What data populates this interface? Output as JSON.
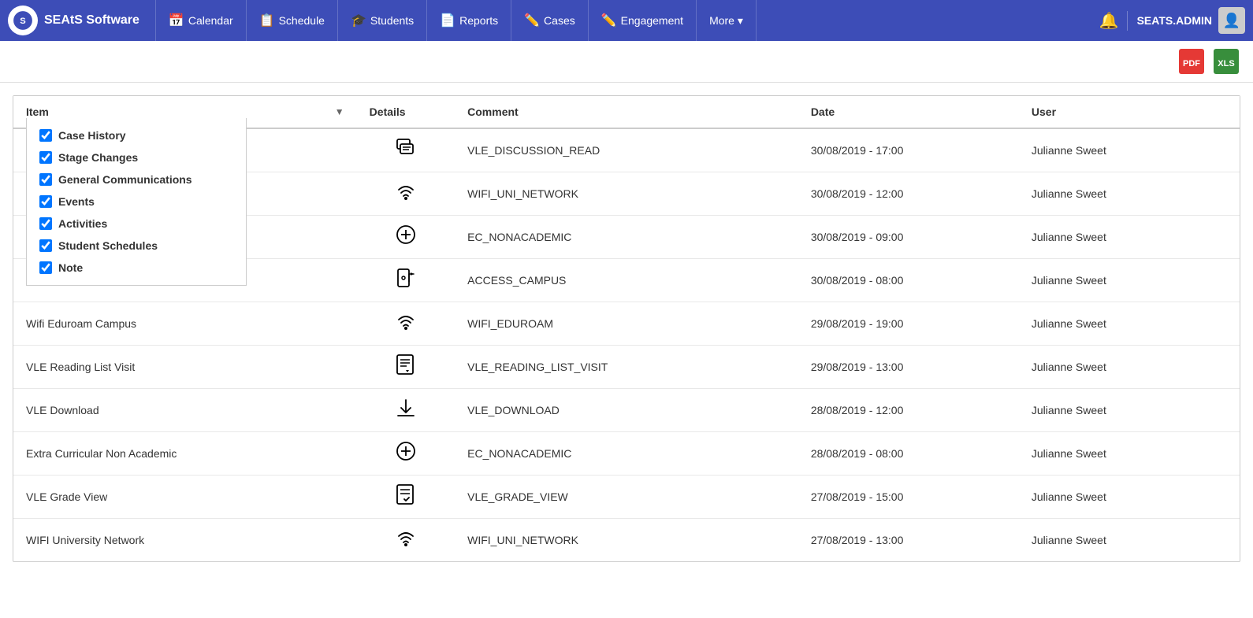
{
  "brand": {
    "name": "SEAtS Software"
  },
  "nav": {
    "items": [
      {
        "label": "Calendar",
        "icon": "📅"
      },
      {
        "label": "Schedule",
        "icon": "📋"
      },
      {
        "label": "Students",
        "icon": "🎓"
      },
      {
        "label": "Reports",
        "icon": "📄"
      },
      {
        "label": "Cases",
        "icon": "✏️"
      },
      {
        "label": "Engagement",
        "icon": "✏️"
      },
      {
        "label": "More ▾",
        "icon": ""
      }
    ]
  },
  "user": {
    "name": "SEATS.ADMIN"
  },
  "toolbar": {
    "pdf_label": "PDF",
    "excel_label": "XLS"
  },
  "table": {
    "columns": {
      "item": "Item",
      "details": "Details",
      "comment": "Comment",
      "date": "Date",
      "user": "User"
    },
    "dropdown_items": [
      {
        "label": "Case History",
        "checked": true
      },
      {
        "label": "Stage Changes",
        "checked": true
      },
      {
        "label": "General Communications",
        "checked": true
      },
      {
        "label": "Events",
        "checked": true
      },
      {
        "label": "Activities",
        "checked": true
      },
      {
        "label": "Student Schedules",
        "checked": true
      },
      {
        "label": "Note",
        "checked": true
      }
    ],
    "rows": [
      {
        "item": "",
        "icon": "💬",
        "comment": "VLE_DISCUSSION_READ",
        "date": "30/08/2019 - 17:00",
        "user": "Julianne Sweet"
      },
      {
        "item": "",
        "icon": "📶",
        "comment": "WIFI_UNI_NETWORK",
        "date": "30/08/2019 - 12:00",
        "user": "Julianne Sweet"
      },
      {
        "item": "",
        "icon": "⊕",
        "comment": "EC_NONACADEMIC",
        "date": "30/08/2019 - 09:00",
        "user": "Julianne Sweet"
      },
      {
        "item": "",
        "icon": "🚪",
        "comment": "ACCESS_CAMPUS",
        "date": "30/08/2019 - 08:00",
        "user": "Julianne Sweet"
      },
      {
        "item": "Wifi Eduroam Campus",
        "icon": "📶",
        "comment": "WIFI_EDUROAM",
        "date": "29/08/2019 - 19:00",
        "user": "Julianne Sweet"
      },
      {
        "item": "VLE Reading List Visit",
        "icon": "📺",
        "comment": "VLE_READING_LIST_VISIT",
        "date": "29/08/2019 - 13:00",
        "user": "Julianne Sweet"
      },
      {
        "item": "VLE Download",
        "icon": "⬇",
        "comment": "VLE_DOWNLOAD",
        "date": "28/08/2019 - 12:00",
        "user": "Julianne Sweet"
      },
      {
        "item": "Extra Curricular Non Academic",
        "icon": "⊕",
        "comment": "EC_NONACADEMIC",
        "date": "28/08/2019 - 08:00",
        "user": "Julianne Sweet"
      },
      {
        "item": "VLE Grade View",
        "icon": "📋",
        "comment": "VLE_GRADE_VIEW",
        "date": "27/08/2019 - 15:00",
        "user": "Julianne Sweet"
      },
      {
        "item": "WIFI University Network",
        "icon": "📶",
        "comment": "WIFI_UNI_NETWORK",
        "date": "27/08/2019 - 13:00",
        "user": "Julianne Sweet"
      }
    ]
  }
}
